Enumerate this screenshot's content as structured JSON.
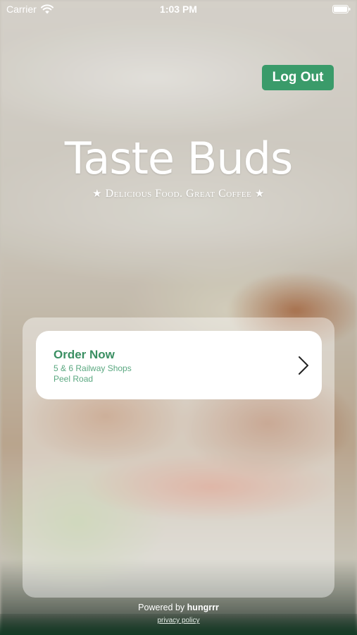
{
  "status_bar": {
    "carrier": "Carrier",
    "time": "1:03 PM"
  },
  "header": {
    "logout_label": "Log Out"
  },
  "brand": {
    "name": "Taste Buds",
    "tagline": "Delicious Food. Great Coffee",
    "star_glyph": "★"
  },
  "order_card": {
    "title": "Order Now",
    "address_line1": "5 & 6 Railway Shops",
    "address_line2": "Peel Road"
  },
  "footer": {
    "powered_prefix": "Powered by",
    "powered_brand": "hungrrr",
    "privacy_label": "privacy policy"
  },
  "colors": {
    "accent_green": "#3a9b6a",
    "order_title": "#3a8f62",
    "address_text": "#5aa880"
  },
  "icons": [
    "wifi-icon",
    "battery-icon",
    "star-icon",
    "chevron-right-icon"
  ]
}
